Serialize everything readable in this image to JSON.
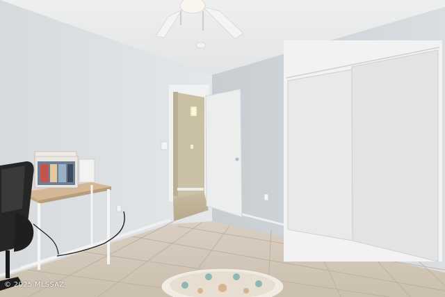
{
  "photo": {
    "watermark": "© 2025 MLSSAZ"
  },
  "colors": {
    "wall_left": "#dde1e4",
    "wall_right": "#d3d8dc",
    "ceiling": "#e8eaeb",
    "floor": "#d8cdbd",
    "door": "#eceeee",
    "closet": "#e6e7e6",
    "desk_top": "#d4b896"
  }
}
